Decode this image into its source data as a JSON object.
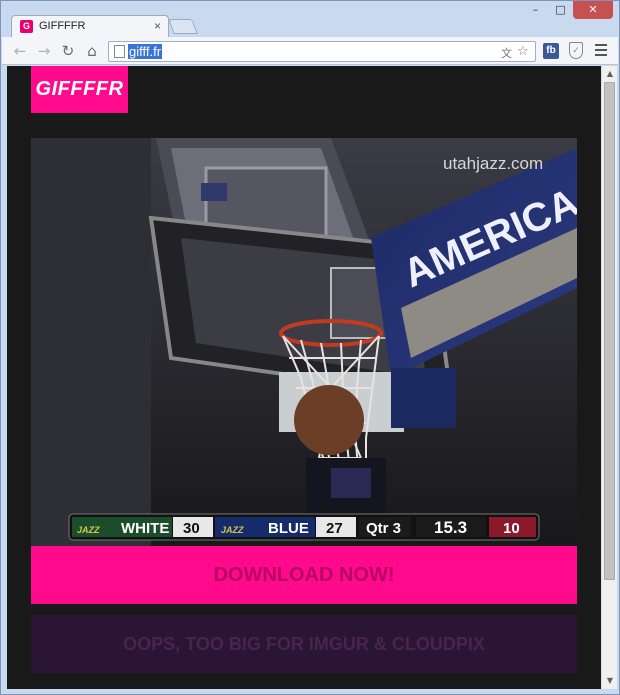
{
  "browser": {
    "tab_title": "GIFFFFR",
    "tab_favicon": "G",
    "url": "gifff.fr",
    "ext_fb": "fb",
    "window_controls": [
      "minimize",
      "maximize",
      "close"
    ]
  },
  "site": {
    "logo_text": "GIFFFFR",
    "download_label": "DOWNLOAD NOW!",
    "imgur_label": "OOPS, TOO BIG FOR IMGUR & CLOUDPIX",
    "accent_color": "#ff0a8c"
  },
  "gif": {
    "watermark": "utahjazz.com",
    "banner_text": "AMERICA",
    "scoreboard": {
      "team1_logo": "JAZZ",
      "team1_name": "WHITE",
      "team1_score": "30",
      "team2_logo": "JAZZ",
      "team2_name": "BLUE",
      "team2_score": "27",
      "period": "Qtr 3",
      "clock": "15.3",
      "shot_clock": "10"
    }
  }
}
